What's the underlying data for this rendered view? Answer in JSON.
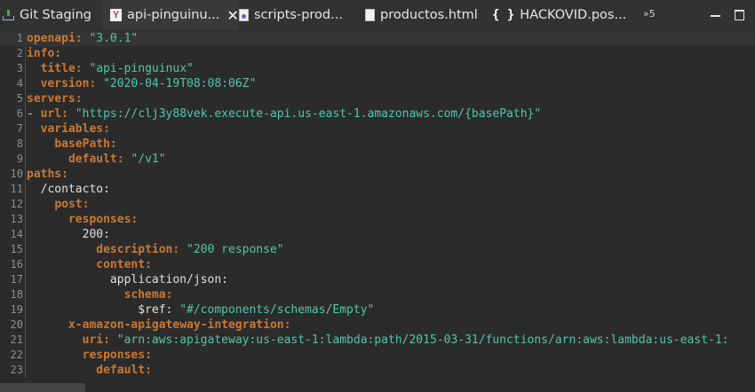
{
  "tabs": [
    {
      "label": "Git Staging",
      "icon": "git-staging-icon"
    },
    {
      "label": "api-pinguinu...",
      "icon": "yaml-file-icon",
      "active": true,
      "close": "✕"
    },
    {
      "label": "scripts-prod...",
      "icon": "script-file-icon"
    },
    {
      "label": "productos.html",
      "icon": "html-file-icon"
    },
    {
      "label": "HACKOVID.pos...",
      "icon": "json-file-icon",
      "glyph": "{ }"
    }
  ],
  "overflow": "»5",
  "editor": {
    "lines": [
      {
        "num": "1",
        "parts": [
          [
            "k",
            "openapi:"
          ],
          [
            "s",
            " \"3.0.1\""
          ]
        ]
      },
      {
        "num": "2",
        "parts": [
          [
            "k",
            "info:"
          ]
        ]
      },
      {
        "num": "3",
        "parts": [
          [
            "p",
            "  "
          ],
          [
            "k",
            "title:"
          ],
          [
            "s",
            " \"api-pinguinux\""
          ]
        ]
      },
      {
        "num": "4",
        "parts": [
          [
            "p",
            "  "
          ],
          [
            "k",
            "version:"
          ],
          [
            "s",
            " \"2020-04-19T08:08:06Z\""
          ]
        ]
      },
      {
        "num": "5",
        "parts": [
          [
            "k",
            "servers:"
          ]
        ]
      },
      {
        "num": "6",
        "parts": [
          [
            "p",
            "- "
          ],
          [
            "k",
            "url:"
          ],
          [
            "s",
            " \"https://clj3y88vek.execute-api.us-east-1.amazonaws.com/{basePath}\""
          ]
        ]
      },
      {
        "num": "7",
        "parts": [
          [
            "p",
            "  "
          ],
          [
            "k",
            "variables:"
          ]
        ]
      },
      {
        "num": "8",
        "parts": [
          [
            "p",
            "    "
          ],
          [
            "k",
            "basePath:"
          ]
        ]
      },
      {
        "num": "9",
        "parts": [
          [
            "p",
            "      "
          ],
          [
            "k",
            "default:"
          ],
          [
            "s",
            " \"/v1\""
          ]
        ]
      },
      {
        "num": "10",
        "parts": [
          [
            "k",
            "paths:"
          ]
        ]
      },
      {
        "num": "11",
        "parts": [
          [
            "p",
            "  /contacto:"
          ]
        ]
      },
      {
        "num": "12",
        "parts": [
          [
            "p",
            "    "
          ],
          [
            "k",
            "post:"
          ]
        ]
      },
      {
        "num": "13",
        "parts": [
          [
            "p",
            "      "
          ],
          [
            "k",
            "responses:"
          ]
        ]
      },
      {
        "num": "14",
        "parts": [
          [
            "p",
            "        200:"
          ]
        ]
      },
      {
        "num": "15",
        "parts": [
          [
            "p",
            "          "
          ],
          [
            "k",
            "description:"
          ],
          [
            "s",
            " \"200 response\""
          ]
        ]
      },
      {
        "num": "16",
        "parts": [
          [
            "p",
            "          "
          ],
          [
            "k",
            "content:"
          ]
        ]
      },
      {
        "num": "17",
        "parts": [
          [
            "p",
            "            application/json:"
          ]
        ]
      },
      {
        "num": "18",
        "parts": [
          [
            "p",
            "              "
          ],
          [
            "k",
            "schema:"
          ]
        ]
      },
      {
        "num": "19",
        "parts": [
          [
            "p",
            "                $ref: "
          ],
          [
            "s",
            "\"#/components/schemas/Empty\""
          ]
        ]
      },
      {
        "num": "20",
        "parts": [
          [
            "p",
            "      "
          ],
          [
            "k",
            "x-amazon-apigateway-integration:"
          ]
        ]
      },
      {
        "num": "21",
        "parts": [
          [
            "p",
            "        "
          ],
          [
            "k",
            "uri:"
          ],
          [
            "s",
            " \"arn:aws:apigateway:us-east-1:lambda:path/2015-03-31/functions/arn:aws:lambda:us-east-1:"
          ]
        ]
      },
      {
        "num": "22",
        "parts": [
          [
            "p",
            "        "
          ],
          [
            "k",
            "responses:"
          ]
        ]
      },
      {
        "num": "23",
        "parts": [
          [
            "p",
            "          "
          ],
          [
            "k",
            "default:"
          ]
        ]
      }
    ]
  },
  "colors": {
    "keyword": "#cc7832",
    "string": "#4ec9a8",
    "text": "#e0e0e0",
    "background": "#2b2b2b"
  }
}
